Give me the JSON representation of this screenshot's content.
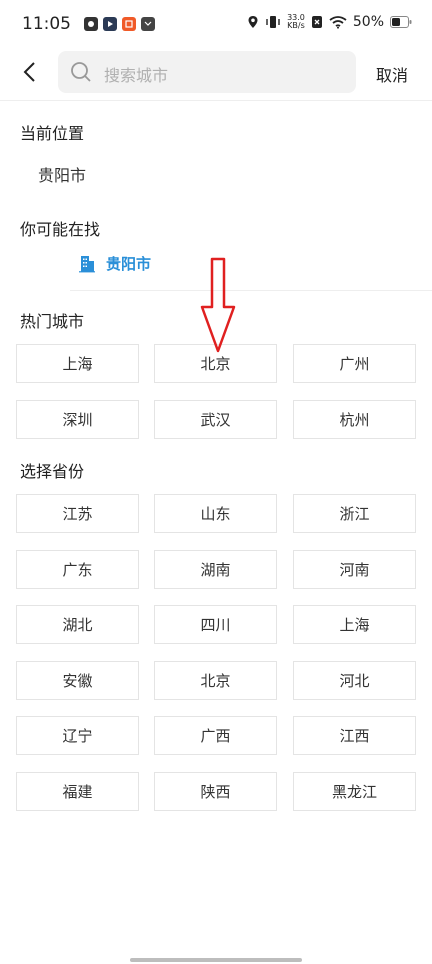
{
  "status_bar": {
    "time": "11:05",
    "net_speed_value": "33.0",
    "net_speed_unit": "KB/s",
    "battery": "50%"
  },
  "header": {
    "search_placeholder": "搜索城市",
    "cancel_label": "取消"
  },
  "current_location": {
    "title": "当前位置",
    "city": "贵阳市"
  },
  "suggestion": {
    "title": "你可能在找",
    "city": "贵阳市",
    "accent_color": "#2a8fd8"
  },
  "hot_cities": {
    "title": "热门城市",
    "items": [
      "上海",
      "北京",
      "广州",
      "深圳",
      "武汉",
      "杭州"
    ]
  },
  "provinces": {
    "title": "选择省份",
    "items": [
      "江苏",
      "山东",
      "浙江",
      "广东",
      "湖南",
      "河南",
      "湖北",
      "四川",
      "上海",
      "安徽",
      "北京",
      "河北",
      "辽宁",
      "广西",
      "江西",
      "福建",
      "陕西",
      "黑龙江"
    ]
  },
  "annotation": {
    "arrow_color": "#e02020",
    "arrow_direction": "down"
  }
}
